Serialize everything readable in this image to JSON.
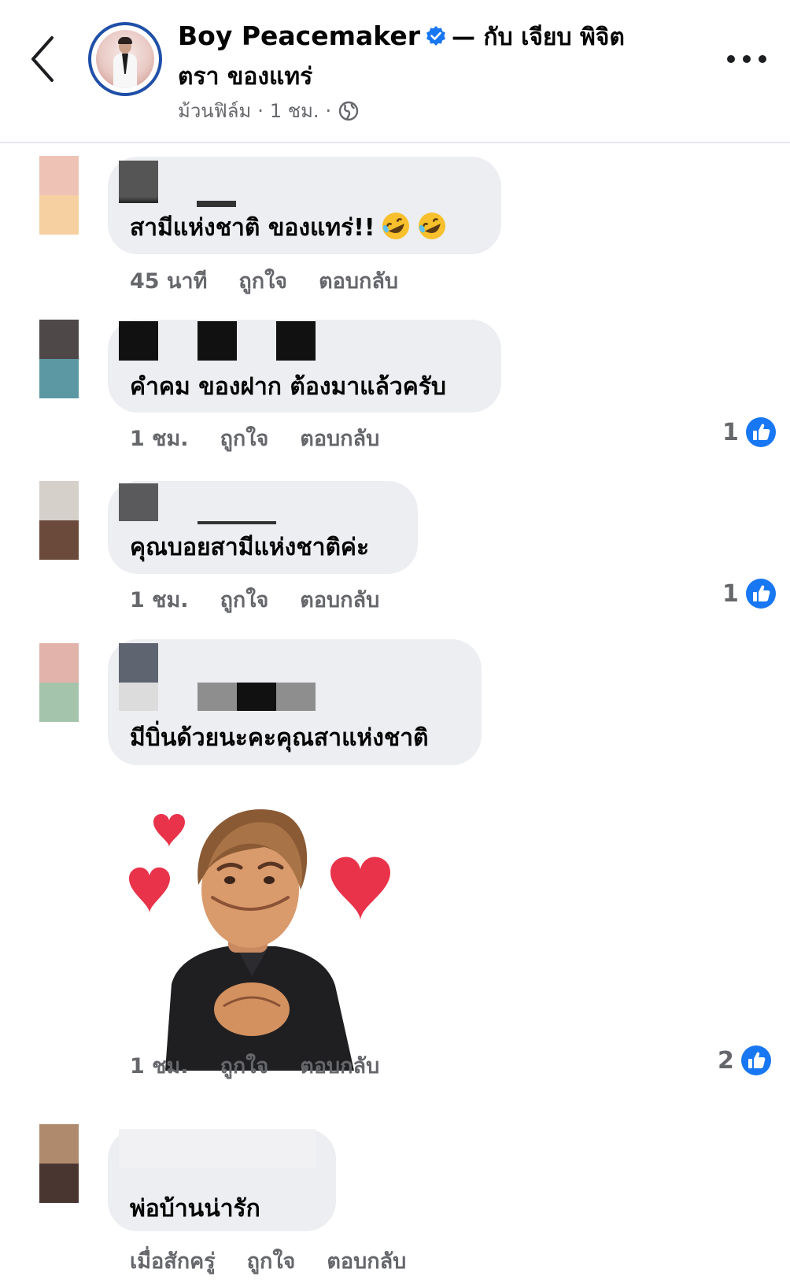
{
  "header": {
    "author": "Boy Peacemaker",
    "with_text": "— กับ เจียบ พิจิต",
    "tagged": "ตรา ของแทร่",
    "post_type": "ม้วนฟิล์ม",
    "separator": "·",
    "time": "1 ชม.",
    "separator2": "·"
  },
  "colors": {
    "accent": "#1877f2",
    "meta_gray": "#65676b",
    "bubble": "#edeef1"
  },
  "comments": [
    {
      "text": "สามีแห่งชาติ ของแทร่!!",
      "time": "45 นาที",
      "like_label": "ถูกใจ",
      "reply_label": "ตอบกลับ",
      "reaction_count": ""
    },
    {
      "text": "คำคม ของฝาก ต้องมาแล้วครับ",
      "time": "1 ชม.",
      "like_label": "ถูกใจ",
      "reply_label": "ตอบกลับ",
      "reaction_count": "1"
    },
    {
      "text": "คุณบอยสามีแห่งชาติค่ะ",
      "time": "1 ชม.",
      "like_label": "ถูกใจ",
      "reply_label": "ตอบกลับ",
      "reaction_count": "1"
    },
    {
      "text": "มีบิ่นด้วยนะคะคุณสาแห่งชาติ",
      "time": "1 ชม.",
      "like_label": "ถูกใจ",
      "reply_label": "ตอบกลับ",
      "reaction_count": "2"
    },
    {
      "text": "พ่อบ้านน่ารัก",
      "time": "เมื่อสักครู่",
      "like_label": "ถูกใจ",
      "reply_label": "ตอบกลับ",
      "reaction_count": ""
    }
  ],
  "icons": {
    "back": "chevron-left-icon",
    "verified": "verified-badge-icon",
    "privacy": "globe-icon",
    "more": "more-options-icon",
    "reaction": "like-reaction-icon",
    "emoji": "rolling-laughing-emoji"
  }
}
